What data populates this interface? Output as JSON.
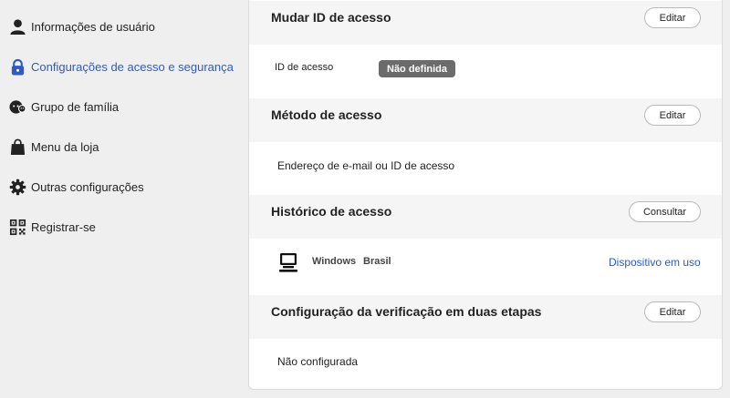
{
  "sidebar": {
    "items": [
      {
        "label": "Informações de usuário",
        "icon": "user-icon"
      },
      {
        "label": "Configurações de acesso e segurança",
        "icon": "lock-icon",
        "active": true
      },
      {
        "label": "Grupo de família",
        "icon": "family-icon"
      },
      {
        "label": "Menu da loja",
        "icon": "shopping-bag-icon"
      },
      {
        "label": "Outras configurações",
        "icon": "gear-icon"
      },
      {
        "label": "Registrar-se",
        "icon": "qr-code-icon"
      }
    ]
  },
  "colors": {
    "accent": "#2e5bbd",
    "badge": "#6b6b6b",
    "header_bg": "#f5f5f5",
    "page_bg": "#efefef"
  },
  "sections": {
    "access_id": {
      "title": "Mudar ID de acesso",
      "button": "Editar",
      "label": "ID de acesso",
      "status": "Não definida"
    },
    "access_method": {
      "title": "Método de acesso",
      "button": "Editar",
      "value": "Endereço de e-mail ou ID de acesso"
    },
    "access_history": {
      "title": "Histórico de acesso",
      "button": "Consultar",
      "device_icon": "laptop-icon",
      "os": "Windows",
      "country": "Brasil",
      "device_status": "Dispositivo em uso"
    },
    "two_step": {
      "title": "Configuração da verificação em duas etapas",
      "button": "Editar",
      "value": "Não configurada"
    }
  }
}
